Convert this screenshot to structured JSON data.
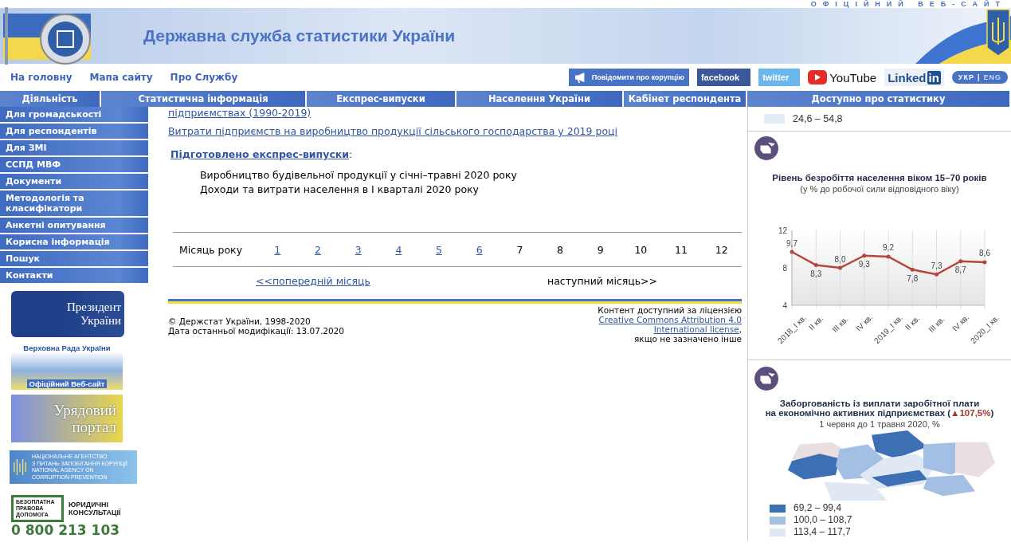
{
  "header": {
    "tagline": "ОФІЦІЙНИЙ ВЕБ-САЙТ",
    "title": "Державна служба статистики України"
  },
  "top_links": [
    "На головну",
    "Мапа сайту",
    "Про Службу"
  ],
  "social": [
    {
      "kind": "report",
      "label": "Повідомити про корупцію"
    },
    {
      "kind": "facebook",
      "label": "facebook"
    },
    {
      "kind": "twitter",
      "label": "twitter"
    },
    {
      "kind": "youtube",
      "label": "YouTube"
    },
    {
      "kind": "linkedin",
      "label": "Linked",
      "suffix": "in"
    },
    {
      "kind": "lang",
      "langs": [
        {
          "label": "УКР",
          "selected": true
        },
        {
          "label": "ENG",
          "selected": false
        }
      ],
      "separator": "|"
    }
  ],
  "nav": [
    "Діяльність",
    "Статистична інформація",
    "Експрес-випуски",
    "Населення України",
    "Кабінет респондента",
    "Доступно про статистику"
  ],
  "sidebar": {
    "items": [
      "Для громадськості",
      "Для респондентів",
      "Для ЗМІ",
      "ССПД МВФ",
      "Документи",
      "Методологія та класифікатори",
      "Анкетні опитування",
      "Корисна інформація",
      "Пошук",
      "Контакти"
    ],
    "banners": [
      {
        "kind": "president",
        "lines": [
          "Президент",
          "України"
        ]
      },
      {
        "kind": "rada",
        "lines": [
          "Верховна Рада України",
          "Офіційний Веб-сайт"
        ]
      },
      {
        "kind": "government",
        "lines": [
          "Урядовий",
          "портал"
        ]
      },
      {
        "kind": "nacp",
        "lines": [
          "НАЦІОНАЛЬНЕ АГЕНТСТВО",
          "З ПИТАНЬ ЗАПОБІГАННЯ КОРУПЦІЇ",
          "NATIONAL AGENCY ON",
          "CORRUPTION PREVENTION"
        ]
      },
      {
        "kind": "legal",
        "lines": [
          "БЕЗОПЛАТНА ПРАВОВА ДОПОМОГА",
          "ЮРИДИЧНІ КОНСУЛЬТАЦІЇ",
          "0 800 213 103"
        ]
      }
    ]
  },
  "main": {
    "links": [
      "підприємствах (1990-2019)",
      "Витрати підприємств на виробництво продукції сільського господарства у 2019 році"
    ],
    "prepared_heading": "Підготовлено експрес-випуски",
    "prepared_suffix": ":",
    "prepared_items": [
      "Виробництво будівельної продукції у січні–травні 2020 року",
      "Доходи та витрати населення в I кварталі 2020 року"
    ],
    "month_label": "Місяць року",
    "months": [
      {
        "label": "1",
        "link": true
      },
      {
        "label": "2",
        "link": true
      },
      {
        "label": "3",
        "link": true
      },
      {
        "label": "4",
        "link": true
      },
      {
        "label": "5",
        "link": true
      },
      {
        "label": "6",
        "link": true
      },
      {
        "label": "7",
        "link": false
      },
      {
        "label": "8",
        "link": false
      },
      {
        "label": "9",
        "link": false
      },
      {
        "label": "10",
        "link": false
      },
      {
        "label": "11",
        "link": false
      },
      {
        "label": "12",
        "link": false
      }
    ],
    "prev_month": {
      "label": "<<попередній місяць",
      "link": true
    },
    "next_month": {
      "label": "наступний місяць>>",
      "link": false
    }
  },
  "footer": {
    "copyright": "© Держстат України, 1998-2020",
    "modified": "Дата останньої модифікації: 13.07.2020",
    "license_lines": [
      {
        "text": "Контент доступний за ліцензією",
        "link": false
      },
      {
        "text": "Creative Commons Attribution 4.0",
        "link": true
      },
      {
        "text": "International license",
        "link": true,
        "suffix": ","
      },
      {
        "text": "якщо не зазначено інше",
        "link": false
      }
    ]
  },
  "right_panel": {
    "top_legend": {
      "label": "24,6 – 54,8",
      "color": "#e3ebf5"
    },
    "unemployment": {
      "title": "Рівень безробіття населення віком 15–70 років",
      "subtitle": "(у % до робочої сили відповідного віку)",
      "chart_data": {
        "type": "line",
        "categories": [
          "2018_I кв.",
          "II кв.",
          "III кв.",
          "IV кв.",
          "2019_I кв.",
          "II кв.",
          "III кв.",
          "IV кв.",
          "2020_I кв."
        ],
        "series": [
          {
            "color": "#b5453d",
            "values": [
              9.7,
              8.3,
              8.0,
              9.3,
              9.2,
              7.8,
              7.3,
              8.7,
              8.6
            ]
          }
        ],
        "value_labels": [
          "9,7",
          "8,3",
          "8,0",
          "9,3",
          "9,2",
          "7,8",
          "7,3",
          "8,7",
          "8,6"
        ],
        "ylim": [
          4,
          12
        ],
        "yticks": [
          4,
          8,
          12
        ],
        "grid": true
      }
    },
    "arrears": {
      "title_line1": "Заборгованість із виплати заробітної плати",
      "title_line2": "на економічно активних підприємствах (",
      "change": "▲107,5%",
      "title_end": ")",
      "subtitle": "1 червня до 1 травня 2020, %",
      "legend": [
        {
          "label": "69,2 – 99,4",
          "color": "#3d6fb5"
        },
        {
          "label": "100,0 – 108,7",
          "color": "#a3bfe3"
        },
        {
          "label": "113,4 – 117,7",
          "color": "#dfe8f3"
        }
      ]
    }
  }
}
